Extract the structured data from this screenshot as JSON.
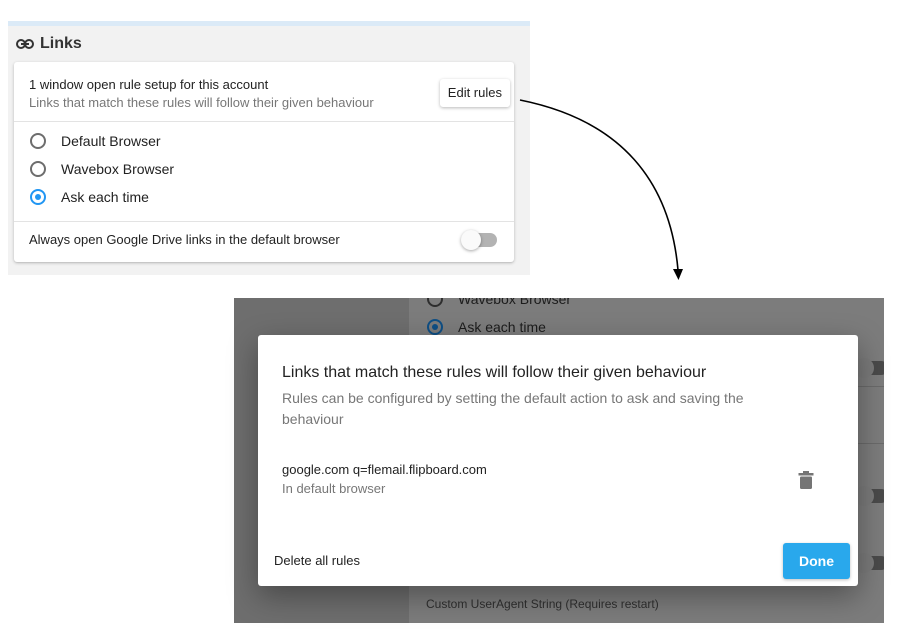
{
  "links_panel": {
    "heading": "Links",
    "rule_count_text": "1 window open rule setup for this account",
    "rule_subtitle": "Links that match these rules will follow their given behaviour",
    "edit_rules_label": "Edit rules",
    "radio_options": [
      {
        "label": "Default Browser",
        "checked": false
      },
      {
        "label": "Wavebox Browser",
        "checked": false
      },
      {
        "label": "Ask each time",
        "checked": true
      }
    ],
    "drive_toggle": {
      "label": "Always open Google Drive links in the default browser",
      "on": false
    }
  },
  "background": {
    "radio_options": [
      {
        "label": "Wavebox Browser",
        "checked": false
      },
      {
        "label": "Ask each time",
        "checked": true
      }
    ],
    "custom_ua_label": "Custom UserAgent String (Requires restart)"
  },
  "dialog": {
    "title": "Links that match these rules will follow their given behaviour",
    "subtitle": "Rules can be configured by setting the default action to ask and saving the behaviour",
    "rules": [
      {
        "pattern": "google.com q=flemail.flipboard.com",
        "action": "In default browser"
      }
    ],
    "delete_all_label": "Delete all rules",
    "done_label": "Done"
  },
  "colors": {
    "accent": "#2196f3",
    "done_button": "#29a8ec",
    "overlay": "#6e6e6e"
  },
  "icons": {
    "header": "link-icon",
    "rule_delete": "trash-icon",
    "connector": "curved-arrow"
  }
}
